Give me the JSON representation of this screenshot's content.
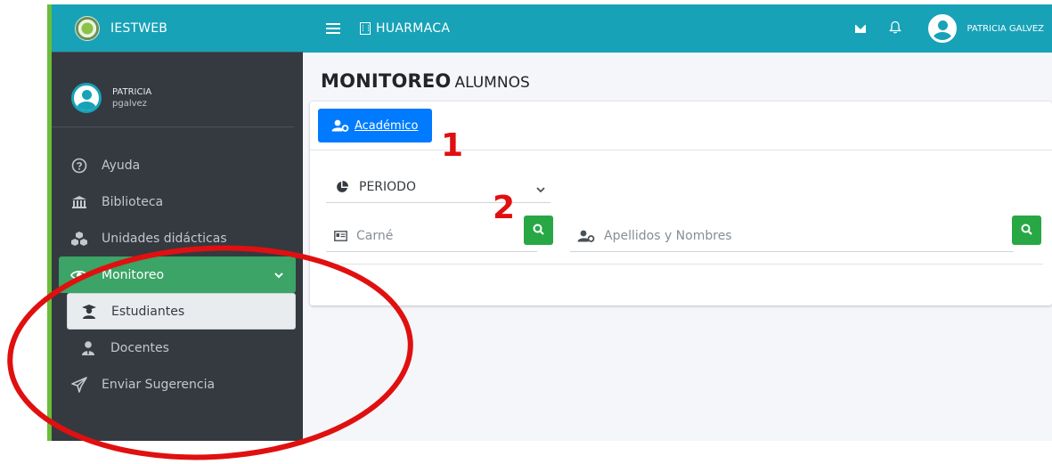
{
  "sidebar": {
    "brand": "IESTWEB",
    "user": {
      "name": "PATRICIA",
      "login": "pgalvez"
    },
    "items": [
      {
        "label": "Ayuda",
        "icon": "question-circle-icon"
      },
      {
        "label": "Biblioteca",
        "icon": "institution-icon"
      },
      {
        "label": "Unidades didácticas",
        "icon": "cubes-icon"
      },
      {
        "label": "Monitoreo",
        "icon": "eye-icon",
        "active": true
      },
      {
        "label": "Estudiantes",
        "icon": "graduate-icon",
        "selected": true
      },
      {
        "label": "Docentes",
        "icon": "teacher-icon"
      },
      {
        "label": "Enviar Sugerencia",
        "icon": "paper-plane-icon"
      }
    ]
  },
  "topbar": {
    "institution": "HUARMACA",
    "user": "PATRICIA GALVEZ"
  },
  "main": {
    "title_strong": "MONITOREO",
    "title_light": "ALUMNOS",
    "tab": "Académico",
    "periodo_label": "PERIODO",
    "carne_placeholder": "Carné",
    "nombres_placeholder": "Apellidos y Nombres"
  },
  "annotations": {
    "step1": "1",
    "step2": "2"
  },
  "colors": {
    "topbar": "#17a2b8",
    "sidebar": "#343a40",
    "active_menu": "#3ba466",
    "primary": "#007bff",
    "search": "#28a745",
    "annotation": "#e01010"
  }
}
